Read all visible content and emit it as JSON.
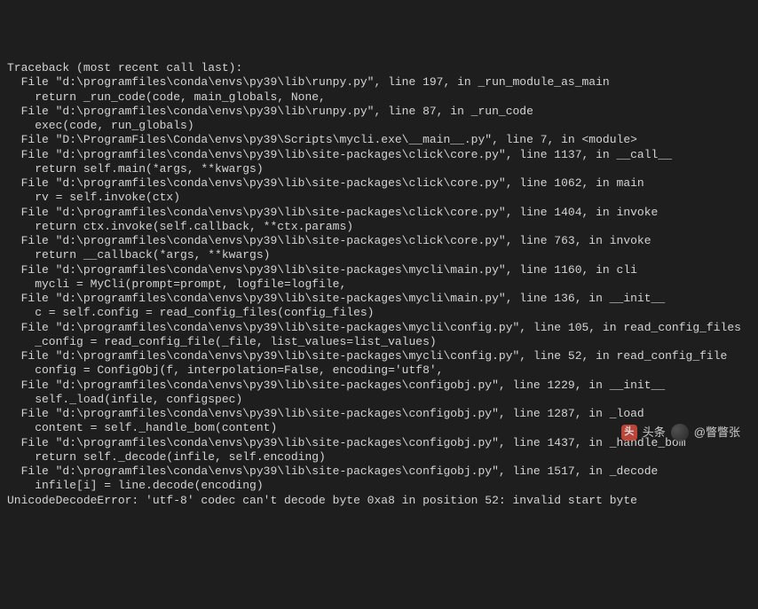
{
  "traceback": {
    "header": "Traceback (most recent call last):",
    "frames": [
      {
        "file": "  File \"d:\\programfiles\\conda\\envs\\py39\\lib\\runpy.py\", line 197, in _run_module_as_main",
        "code": "    return _run_code(code, main_globals, None,"
      },
      {
        "file": "  File \"d:\\programfiles\\conda\\envs\\py39\\lib\\runpy.py\", line 87, in _run_code",
        "code": "    exec(code, run_globals)"
      },
      {
        "file": "  File \"D:\\ProgramFiles\\Conda\\envs\\py39\\Scripts\\mycli.exe\\__main__.py\", line 7, in <module>",
        "code": ""
      },
      {
        "file": "  File \"d:\\programfiles\\conda\\envs\\py39\\lib\\site-packages\\click\\core.py\", line 1137, in __call__",
        "code": "    return self.main(*args, **kwargs)"
      },
      {
        "file": "  File \"d:\\programfiles\\conda\\envs\\py39\\lib\\site-packages\\click\\core.py\", line 1062, in main",
        "code": "    rv = self.invoke(ctx)"
      },
      {
        "file": "  File \"d:\\programfiles\\conda\\envs\\py39\\lib\\site-packages\\click\\core.py\", line 1404, in invoke",
        "code": "    return ctx.invoke(self.callback, **ctx.params)"
      },
      {
        "file": "  File \"d:\\programfiles\\conda\\envs\\py39\\lib\\site-packages\\click\\core.py\", line 763, in invoke",
        "code": "    return __callback(*args, **kwargs)"
      },
      {
        "file": "  File \"d:\\programfiles\\conda\\envs\\py39\\lib\\site-packages\\mycli\\main.py\", line 1160, in cli",
        "code": "    mycli = MyCli(prompt=prompt, logfile=logfile,"
      },
      {
        "file": "  File \"d:\\programfiles\\conda\\envs\\py39\\lib\\site-packages\\mycli\\main.py\", line 136, in __init__",
        "code": "    c = self.config = read_config_files(config_files)"
      },
      {
        "file": "  File \"d:\\programfiles\\conda\\envs\\py39\\lib\\site-packages\\mycli\\config.py\", line 105, in read_config_files",
        "code": "    _config = read_config_file(_file, list_values=list_values)"
      },
      {
        "file": "  File \"d:\\programfiles\\conda\\envs\\py39\\lib\\site-packages\\mycli\\config.py\", line 52, in read_config_file",
        "code": "    config = ConfigObj(f, interpolation=False, encoding='utf8',"
      },
      {
        "file": "  File \"d:\\programfiles\\conda\\envs\\py39\\lib\\site-packages\\configobj.py\", line 1229, in __init__",
        "code": "    self._load(infile, configspec)"
      },
      {
        "file": "  File \"d:\\programfiles\\conda\\envs\\py39\\lib\\site-packages\\configobj.py\", line 1287, in _load",
        "code": "    content = self._handle_bom(content)"
      },
      {
        "file": "  File \"d:\\programfiles\\conda\\envs\\py39\\lib\\site-packages\\configobj.py\", line 1437, in _handle_bom",
        "code": "    return self._decode(infile, self.encoding)"
      },
      {
        "file": "  File \"d:\\programfiles\\conda\\envs\\py39\\lib\\site-packages\\configobj.py\", line 1517, in _decode",
        "code": "    infile[i] = line.decode(encoding)"
      }
    ],
    "error": "UnicodeDecodeError: 'utf-8' codec can't decode byte 0xa8 in position 52: invalid start byte"
  },
  "watermark": {
    "platform": "头条",
    "username": "@瞥瞥张"
  }
}
